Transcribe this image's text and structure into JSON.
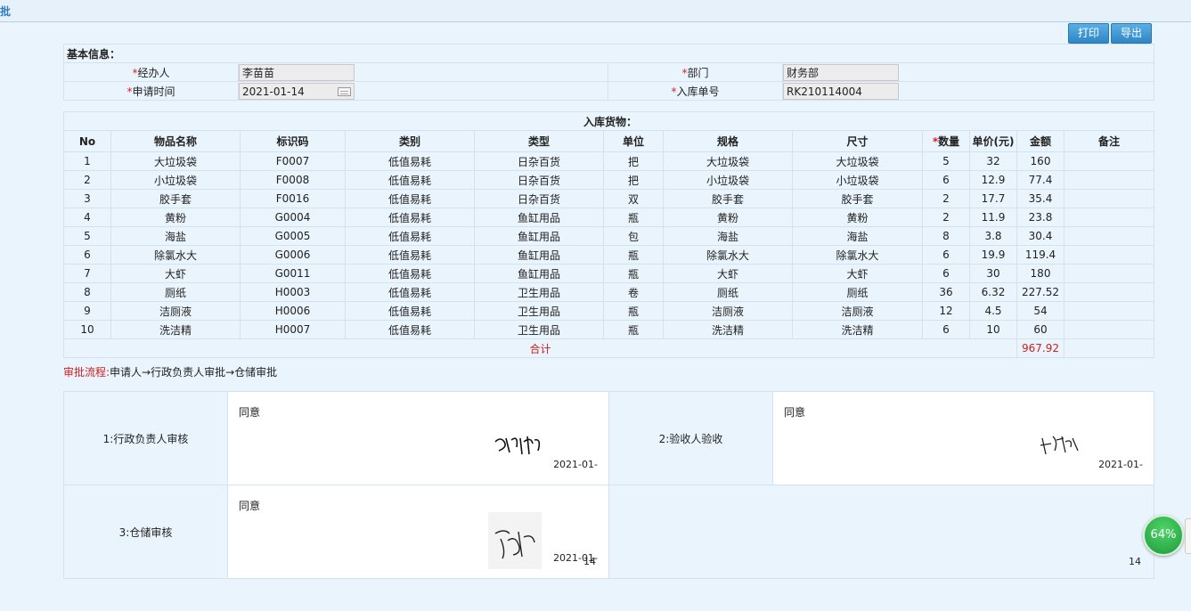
{
  "window": {
    "title": "批"
  },
  "toolbar": {
    "print_label": "打印",
    "export_label": "导出"
  },
  "basic": {
    "section_title": "基本信息：",
    "handler_label": "经办人",
    "handler_value": "李苗苗",
    "dept_label": "部门",
    "dept_value": "财务部",
    "apply_time_label": "申请时间",
    "apply_time_value": "2021-01-14",
    "order_no_label": "入库单号",
    "order_no_value": "RK210114004",
    "required_mark": "*"
  },
  "goods": {
    "section_title": "入库货物：",
    "headers": {
      "no": "No",
      "name": "物品名称",
      "code": "标识码",
      "category": "类别",
      "type": "类型",
      "unit": "单位",
      "spec": "规格",
      "size": "尺寸",
      "qty": "数量",
      "price": "单价(元)",
      "amount": "金额",
      "remark": "备注"
    },
    "rows": [
      {
        "no": "1",
        "name": "大垃圾袋",
        "code": "F0007",
        "category": "低值易耗",
        "type": "日杂百货",
        "unit": "把",
        "spec": "大垃圾袋",
        "size": "大垃圾袋",
        "qty": "5",
        "price": "32",
        "amount": "160",
        "remark": ""
      },
      {
        "no": "2",
        "name": "小垃圾袋",
        "code": "F0008",
        "category": "低值易耗",
        "type": "日杂百货",
        "unit": "把",
        "spec": "小垃圾袋",
        "size": "小垃圾袋",
        "qty": "6",
        "price": "12.9",
        "amount": "77.4",
        "remark": ""
      },
      {
        "no": "3",
        "name": "胶手套",
        "code": "F0016",
        "category": "低值易耗",
        "type": "日杂百货",
        "unit": "双",
        "spec": "胶手套",
        "size": "胶手套",
        "qty": "2",
        "price": "17.7",
        "amount": "35.4",
        "remark": ""
      },
      {
        "no": "4",
        "name": "黄粉",
        "code": "G0004",
        "category": "低值易耗",
        "type": "鱼缸用品",
        "unit": "瓶",
        "spec": "黄粉",
        "size": "黄粉",
        "qty": "2",
        "price": "11.9",
        "amount": "23.8",
        "remark": ""
      },
      {
        "no": "5",
        "name": "海盐",
        "code": "G0005",
        "category": "低值易耗",
        "type": "鱼缸用品",
        "unit": "包",
        "spec": "海盐",
        "size": "海盐",
        "qty": "8",
        "price": "3.8",
        "amount": "30.4",
        "remark": ""
      },
      {
        "no": "6",
        "name": "除氯水大",
        "code": "G0006",
        "category": "低值易耗",
        "type": "鱼缸用品",
        "unit": "瓶",
        "spec": "除氯水大",
        "size": "除氯水大",
        "qty": "6",
        "price": "19.9",
        "amount": "119.4",
        "remark": ""
      },
      {
        "no": "7",
        "name": "大虾",
        "code": "G0011",
        "category": "低值易耗",
        "type": "鱼缸用品",
        "unit": "瓶",
        "spec": "大虾",
        "size": "大虾",
        "qty": "6",
        "price": "30",
        "amount": "180",
        "remark": ""
      },
      {
        "no": "8",
        "name": "厕纸",
        "code": "H0003",
        "category": "低值易耗",
        "type": "卫生用品",
        "unit": "卷",
        "spec": "厕纸",
        "size": "厕纸",
        "qty": "36",
        "price": "6.32",
        "amount": "227.52",
        "remark": ""
      },
      {
        "no": "9",
        "name": "洁厕液",
        "code": "H0006",
        "category": "低值易耗",
        "type": "卫生用品",
        "unit": "瓶",
        "spec": "洁厕液",
        "size": "洁厕液",
        "qty": "12",
        "price": "4.5",
        "amount": "54",
        "remark": ""
      },
      {
        "no": "10",
        "name": "洗洁精",
        "code": "H0007",
        "category": "低值易耗",
        "type": "卫生用品",
        "unit": "瓶",
        "spec": "洗洁精",
        "size": "洗洁精",
        "qty": "6",
        "price": "10",
        "amount": "60",
        "remark": ""
      }
    ],
    "total_label": "合计",
    "total_amount": "967.92"
  },
  "flow": {
    "label": "审批流程:",
    "steps": "申请人→行政负责人审批→仓储审批"
  },
  "approvals": [
    {
      "label": "1:行政负责人审核",
      "opinion": "同意",
      "date": "2021-01-",
      "page": ""
    },
    {
      "label": "2:验收人验收",
      "opinion": "同意",
      "date": "2021-01-",
      "page": ""
    },
    {
      "label": "3:仓储审核",
      "opinion": "同意",
      "date": "2021-01-",
      "page": "14"
    }
  ],
  "empty_page": "14",
  "zoom": {
    "value": "64%"
  },
  "colors": {
    "accent": "#2f86c7",
    "required": "#e02020",
    "zoom": "#1f9a3a"
  }
}
